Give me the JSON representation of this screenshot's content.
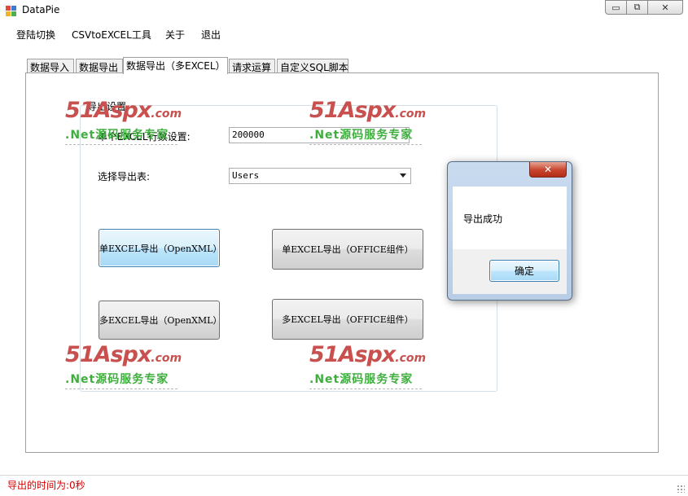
{
  "window": {
    "title": "DataPie",
    "minimize_glyph": "▭",
    "restore_glyph": "⧉",
    "close_glyph": "✕"
  },
  "menu": {
    "items": [
      "登陆切换",
      "CSVtoEXCEL工具",
      "关于",
      "退出"
    ]
  },
  "tabs": {
    "items": [
      "数据导入",
      "数据导出",
      "数据导出（多EXCEL）",
      "请求运算",
      "自定义SQL脚本"
    ],
    "active_index": 2
  },
  "export_group": {
    "title": "导出设置",
    "rows_label": "单个EXCEL行数设置:",
    "rows_value": "200000",
    "table_label": "选择导出表:",
    "table_value": "Users",
    "buttons": {
      "single_openxml": "单EXCEL导出（OpenXML）",
      "single_office": "单EXCEL导出（OFFICE组件）",
      "multi_openxml": "多EXCEL导出（OpenXML）",
      "multi_office": "多EXCEL导出（OFFICE组件）"
    }
  },
  "watermark": {
    "logo": "51Aspx",
    "domain": ".com",
    "tagline": ".Net源码服务专家"
  },
  "dialog": {
    "close_glyph": "✕",
    "message": "导出成功",
    "ok_label": "确定"
  },
  "status": {
    "text": "导出的时间为:0秒"
  },
  "colors": {
    "status_text": "#d40000",
    "watermark_red": "#c8504f",
    "watermark_green": "#3fae3f",
    "focus_border": "#3c7fb1"
  }
}
